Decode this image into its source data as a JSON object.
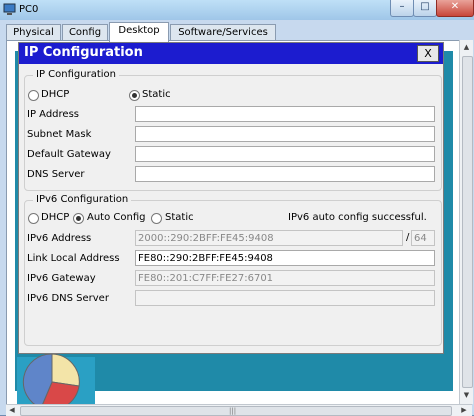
{
  "window": {
    "title": "PC0",
    "minimize": "–",
    "maximize": "□",
    "close": "✕"
  },
  "tabs": [
    {
      "label": "Physical"
    },
    {
      "label": "Config"
    },
    {
      "label": "Desktop"
    },
    {
      "label": "Software/Services"
    }
  ],
  "active_tab": "Desktop",
  "dialog": {
    "title": "IP Configuration",
    "close_label": "X",
    "ipv4": {
      "group_label": "IP Configuration",
      "dhcp_label": "DHCP",
      "static_label": "Static",
      "selected": "Static",
      "fields": [
        {
          "label": "IP Address",
          "value": ""
        },
        {
          "label": "Subnet Mask",
          "value": ""
        },
        {
          "label": "Default Gateway",
          "value": ""
        },
        {
          "label": "DNS Server",
          "value": ""
        }
      ]
    },
    "ipv6": {
      "group_label": "IPv6 Configuration",
      "dhcp_label": "DHCP",
      "auto_label": "Auto Config",
      "static_label": "Static",
      "selected": "Auto Config",
      "status": "IPv6 auto config successful.",
      "ipv6_address_label": "IPv6 Address",
      "ipv6_address_value": "2000::290:2BFF:FE45:9408",
      "prefix_separator": "/",
      "prefix_value": "64",
      "link_local_label": "Link Local Address",
      "link_local_value": "FE80::290:2BFF:FE45:9408",
      "gateway_label": "IPv6 Gateway",
      "gateway_value": "FE80::201:C7FF:FE27:6701",
      "dns_label": "IPv6 DNS Server",
      "dns_value": ""
    }
  },
  "scrollbar": {
    "up_arrow": "▲",
    "down_arrow": "▼",
    "left_arrow": "◀",
    "right_arrow": "▶",
    "grip": "|||"
  },
  "icons": {
    "app": "pc-icon",
    "desktop_app": "pie-chart-icon"
  },
  "colors": {
    "dialog_header": "#1c1ccf",
    "desktop_bg": "#1f8aa8"
  }
}
